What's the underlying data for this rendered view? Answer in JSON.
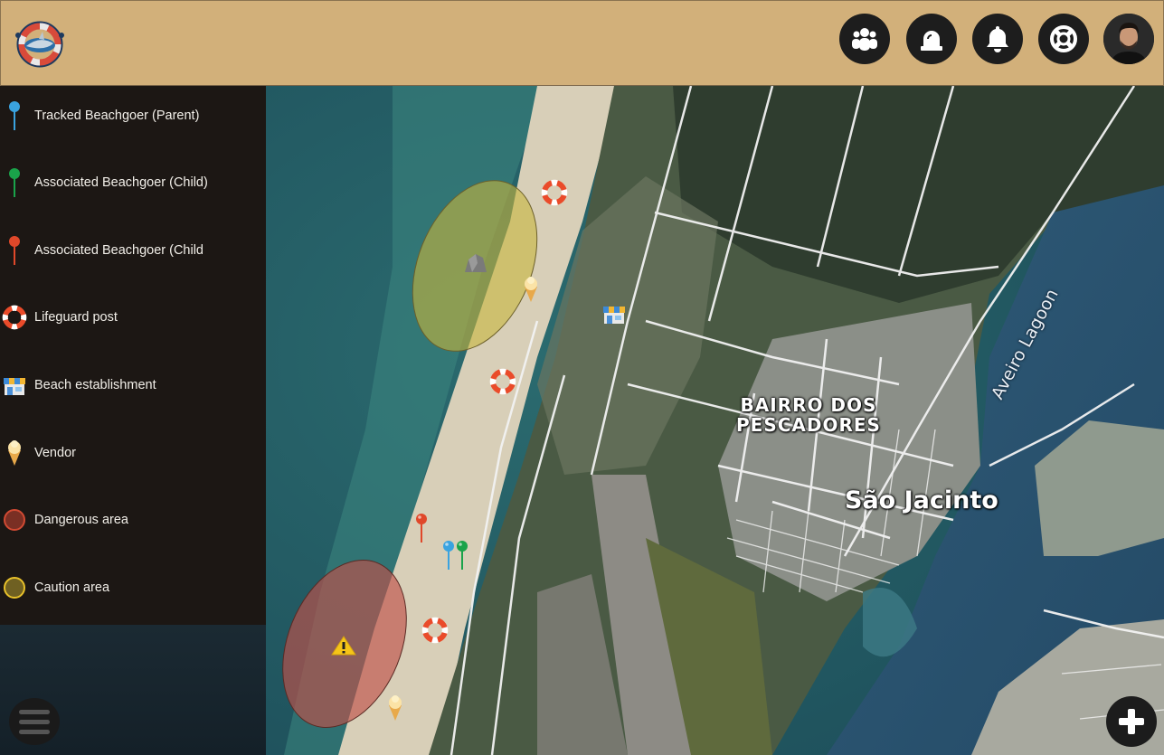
{
  "header": {
    "logo_icon": "lifebuoy-shark-logo",
    "buttons": [
      {
        "name": "group-icon"
      },
      {
        "name": "alarm-siren-icon"
      },
      {
        "name": "bell-icon"
      },
      {
        "name": "lifebuoy-icon"
      }
    ],
    "avatar": "user-avatar",
    "background": "#d2b07a"
  },
  "legend": {
    "items": [
      {
        "label": "Tracked Beachgoer (Parent)",
        "icon": "blue-pin-icon",
        "color": "#3aa3e0"
      },
      {
        "label": "Associated Beachgoer (Child)",
        "icon": "green-pin-icon",
        "color": "#1aa34a"
      },
      {
        "label": "Associated Beachgoer (Child",
        "icon": "red-pin-icon",
        "color": "#e0482a"
      },
      {
        "label": "Lifeguard post",
        "icon": "lifebuoy-icon",
        "color": "#ea4b2a"
      },
      {
        "label": "Beach establishment",
        "icon": "shop-icon",
        "color": "#4a90d9"
      },
      {
        "label": "Vendor",
        "icon": "ice-cream-icon",
        "color": "#f3c96a"
      },
      {
        "label": "Dangerous area",
        "icon": "red-circle-icon",
        "color": "#d24a33"
      },
      {
        "label": "Caution area",
        "icon": "yellow-circle-icon",
        "color": "#e8c12a"
      }
    ]
  },
  "map": {
    "labels": {
      "bairro": "BAIRRO DOS\nPESCADORES",
      "sao": "São Jacinto",
      "lagoon": "Aveiro Lagoon"
    },
    "zones": [
      {
        "type": "caution",
        "color": "#c8b53c"
      },
      {
        "type": "danger",
        "color": "#c0524a"
      }
    ]
  },
  "controls": {
    "menu": "hamburger-menu-icon",
    "add": "plus-icon"
  }
}
